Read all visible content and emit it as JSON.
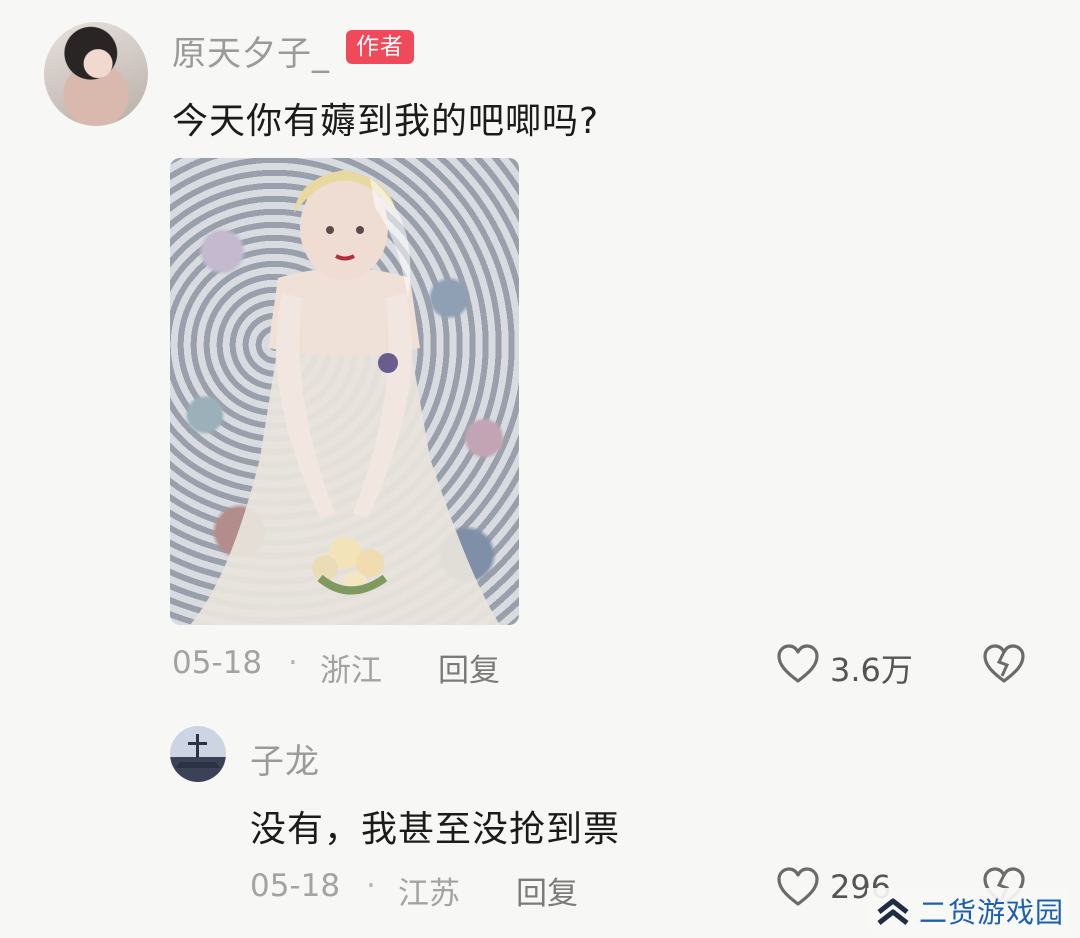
{
  "comment": {
    "username": "原天夕子_",
    "badge": "作者",
    "text": "今天你有薅到我的吧唧吗?",
    "date": "05-18",
    "separator": "·",
    "location": "浙江",
    "reply_label": "回复",
    "likes": "3.6万"
  },
  "reply": {
    "username": "子龙",
    "text": "没有，我甚至没抢到票",
    "date": "05-18",
    "separator": "·",
    "location": "江苏",
    "reply_label": "回复",
    "likes": "296"
  },
  "watermark": {
    "text": "二货游戏园"
  },
  "colors": {
    "badge": "#f04a5a",
    "meta": "#a3a3a3",
    "watermark": "#1b5fb4"
  }
}
